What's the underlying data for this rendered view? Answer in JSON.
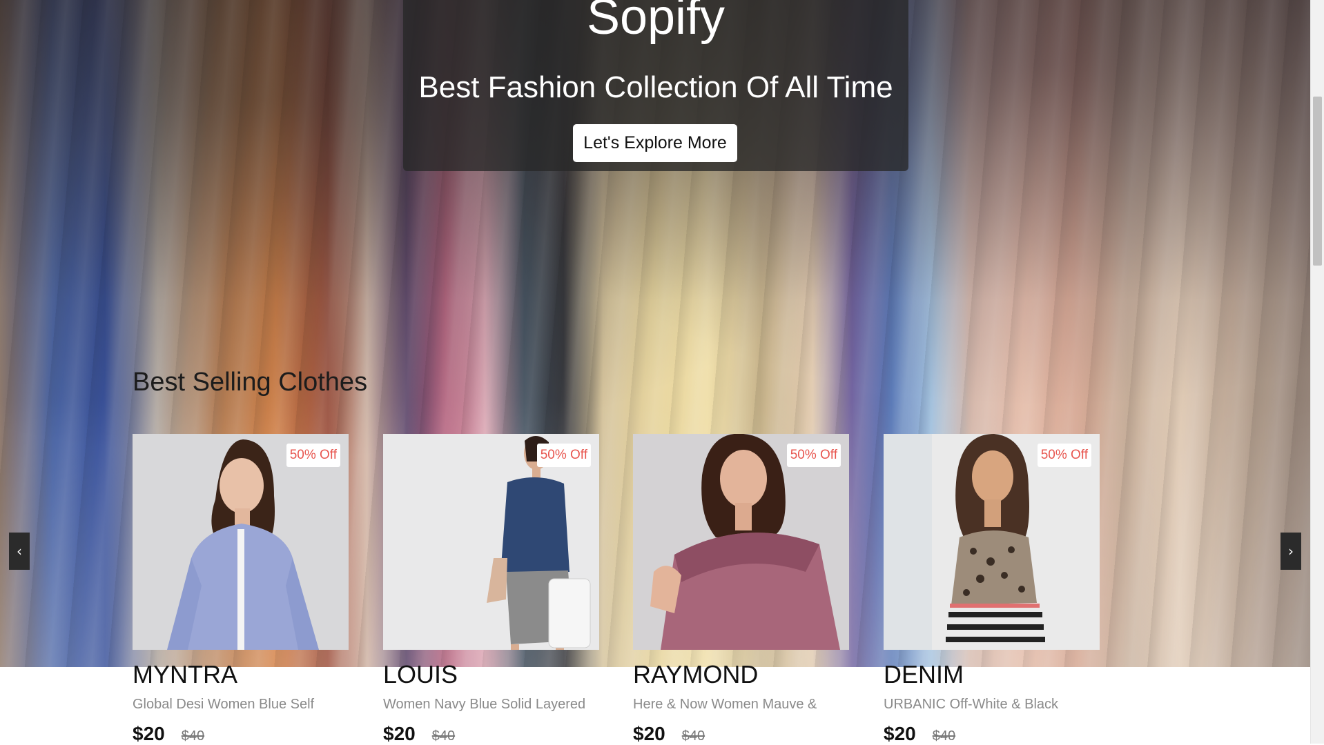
{
  "hero": {
    "brand": "Sopify",
    "tagline": "Best Fashion Collection Of All Time",
    "cta_label": "Let's Explore More"
  },
  "section": {
    "title": "Best Selling Clothes"
  },
  "carousel": {
    "prev_icon": "‹",
    "next_icon": "›"
  },
  "products": [
    {
      "brand": "MYNTRA",
      "desc": "Global Desi Women Blue Self",
      "badge": "50% Off",
      "price": "$20",
      "old_price": "$40"
    },
    {
      "brand": "LOUIS",
      "desc": "Women Navy Blue Solid Layered",
      "badge": "50% Off",
      "price": "$20",
      "old_price": "$40"
    },
    {
      "brand": "RAYMOND",
      "desc": "Here & Now Women Mauve &",
      "badge": "50% Off",
      "price": "$20",
      "old_price": "$40"
    },
    {
      "brand": "DENIM",
      "desc": "URBANIC Off-White & Black",
      "badge": "50% Off",
      "price": "$20",
      "old_price": "$40"
    }
  ],
  "colors": {
    "badge_text": "#e8564f",
    "hero_overlay": "#282828",
    "text_dark": "#111111"
  }
}
